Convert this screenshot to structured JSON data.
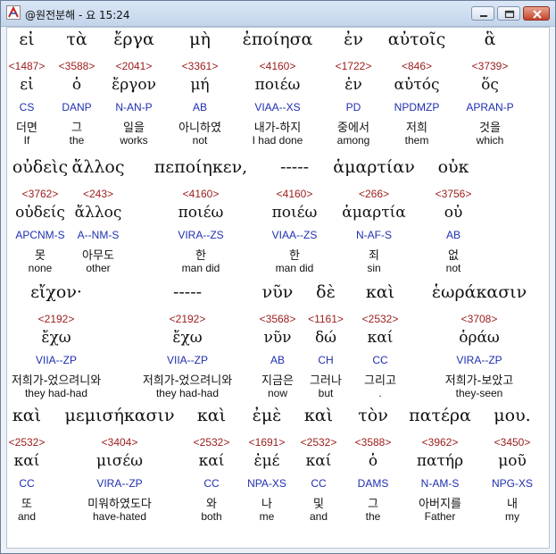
{
  "window": {
    "title": "@원전분해 - 요 15:24",
    "minimize_label": "",
    "maximize_label": "",
    "close_label": ""
  },
  "rows": [
    {
      "words": [
        {
          "greek": "εἰ",
          "num": "<1487>",
          "lemma": "εἰ",
          "parse": "CS",
          "korean": "더면",
          "english": "If"
        },
        {
          "greek": "τὰ",
          "num": "<3588>",
          "lemma": "ὁ",
          "parse": "DANP",
          "korean": "그",
          "english": "the"
        },
        {
          "greek": "ἔργα",
          "num": "<2041>",
          "lemma": "ἔργον",
          "parse": "N-AN-P",
          "korean": "일을",
          "english": "works"
        },
        {
          "greek": "μὴ",
          "num": "<3361>",
          "lemma": "μή",
          "parse": "AB",
          "korean": "아니하였",
          "english": "not"
        },
        {
          "greek": "ἐποίησα",
          "num": "<4160>",
          "lemma": "ποιέω",
          "parse": "VIAA--XS",
          "korean": "내가-하지",
          "english": "I had done"
        },
        {
          "greek": "ἐν",
          "num": "<1722>",
          "lemma": "ἐν",
          "parse": "PD",
          "korean": "중에서",
          "english": "among"
        },
        {
          "greek": "αὐτοῖς",
          "num": "<846>",
          "lemma": "αὐτός",
          "parse": "NPDMZP",
          "korean": "저희",
          "english": "them"
        },
        {
          "greek": "ἃ",
          "num": "<3739>",
          "lemma": "ὅς",
          "parse": "APRAN-P",
          "korean": "것을",
          "english": "which"
        }
      ]
    },
    {
      "words": [
        {
          "greek": "οὐδεὶς",
          "num": "<3762>",
          "lemma": "οὐδείς",
          "parse": "APCNM-S",
          "korean": "못",
          "english": "none"
        },
        {
          "greek": "ἄλλος",
          "num": "<243>",
          "lemma": "ἄλλος",
          "parse": "A--NM-S",
          "korean": "아무도",
          "english": "other"
        },
        {
          "greek": "πεποίηκεν,",
          "num": "<4160>",
          "lemma": "ποιέω",
          "parse": "VIRA--ZS",
          "korean": "한",
          "english": "man did"
        },
        {
          "greek": "-----",
          "num": "<4160>",
          "lemma": "ποιέω",
          "parse": "VIAA--ZS",
          "korean": "한",
          "english": "man did"
        },
        {
          "greek": "ἁμαρτίαν",
          "num": "<266>",
          "lemma": "ἁμαρτία",
          "parse": "N-AF-S",
          "korean": "죄",
          "english": "sin"
        },
        {
          "greek": "οὐκ",
          "num": "<3756>",
          "lemma": "οὐ",
          "parse": "AB",
          "korean": "없",
          "english": "not"
        }
      ]
    },
    {
      "words": [
        {
          "greek": "εἴχον·",
          "num": "<2192>",
          "lemma": "ἔχω",
          "parse": "VIIA--ZP",
          "korean": "저희가-었으려니와",
          "english": "they had-had"
        },
        {
          "greek": "-----",
          "num": "<2192>",
          "lemma": "ἔχω",
          "parse": "VIIA--ZP",
          "korean": "저희가-었으려니와",
          "english": "they had-had"
        },
        {
          "greek": "νῦν",
          "num": "<3568>",
          "lemma": "νῦν",
          "parse": "AB",
          "korean": "지금은",
          "english": "now"
        },
        {
          "greek": "δὲ",
          "num": "<1161>",
          "lemma": "δώ",
          "parse": "CH",
          "korean": "그러나",
          "english": "but"
        },
        {
          "greek": "καὶ",
          "num": "<2532>",
          "lemma": "καί",
          "parse": "CC",
          "korean": "그리고",
          "english": "."
        },
        {
          "greek": "ἑωράκασιν",
          "num": "<3708>",
          "lemma": "ὁράω",
          "parse": "VIRA--ZP",
          "korean": "저희가-보았고",
          "english": "they-seen"
        }
      ]
    },
    {
      "words": [
        {
          "greek": "καὶ",
          "num": "<2532>",
          "lemma": "καί",
          "parse": "CC",
          "korean": "또",
          "english": "and"
        },
        {
          "greek": "μεμισήκασιν",
          "num": "<3404>",
          "lemma": "μισέω",
          "parse": "VIRA--ZP",
          "korean": "미워하였도다",
          "english": "have-hated"
        },
        {
          "greek": "καὶ",
          "num": "<2532>",
          "lemma": "καί",
          "parse": "CC",
          "korean": "와",
          "english": "both"
        },
        {
          "greek": "ἐμὲ",
          "num": "<1691>",
          "lemma": "ἐμέ",
          "parse": "NPA-XS",
          "korean": "나",
          "english": "me"
        },
        {
          "greek": "καὶ",
          "num": "<2532>",
          "lemma": "καί",
          "parse": "CC",
          "korean": "및",
          "english": "and"
        },
        {
          "greek": "τὸν",
          "num": "<3588>",
          "lemma": "ὁ",
          "parse": "DAMS",
          "korean": "그",
          "english": "the"
        },
        {
          "greek": "πατέρα",
          "num": "<3962>",
          "lemma": "πατήρ",
          "parse": "N-AM-S",
          "korean": "아버지를",
          "english": "Father"
        },
        {
          "greek": "μου.",
          "num": "<3450>",
          "lemma": "μοῦ",
          "parse": "NPG-XS",
          "korean": "내",
          "english": "my"
        }
      ]
    }
  ],
  "colors": {
    "strongs": "#9b1b1b",
    "parse": "#1f2fb0",
    "text": "#111111"
  }
}
